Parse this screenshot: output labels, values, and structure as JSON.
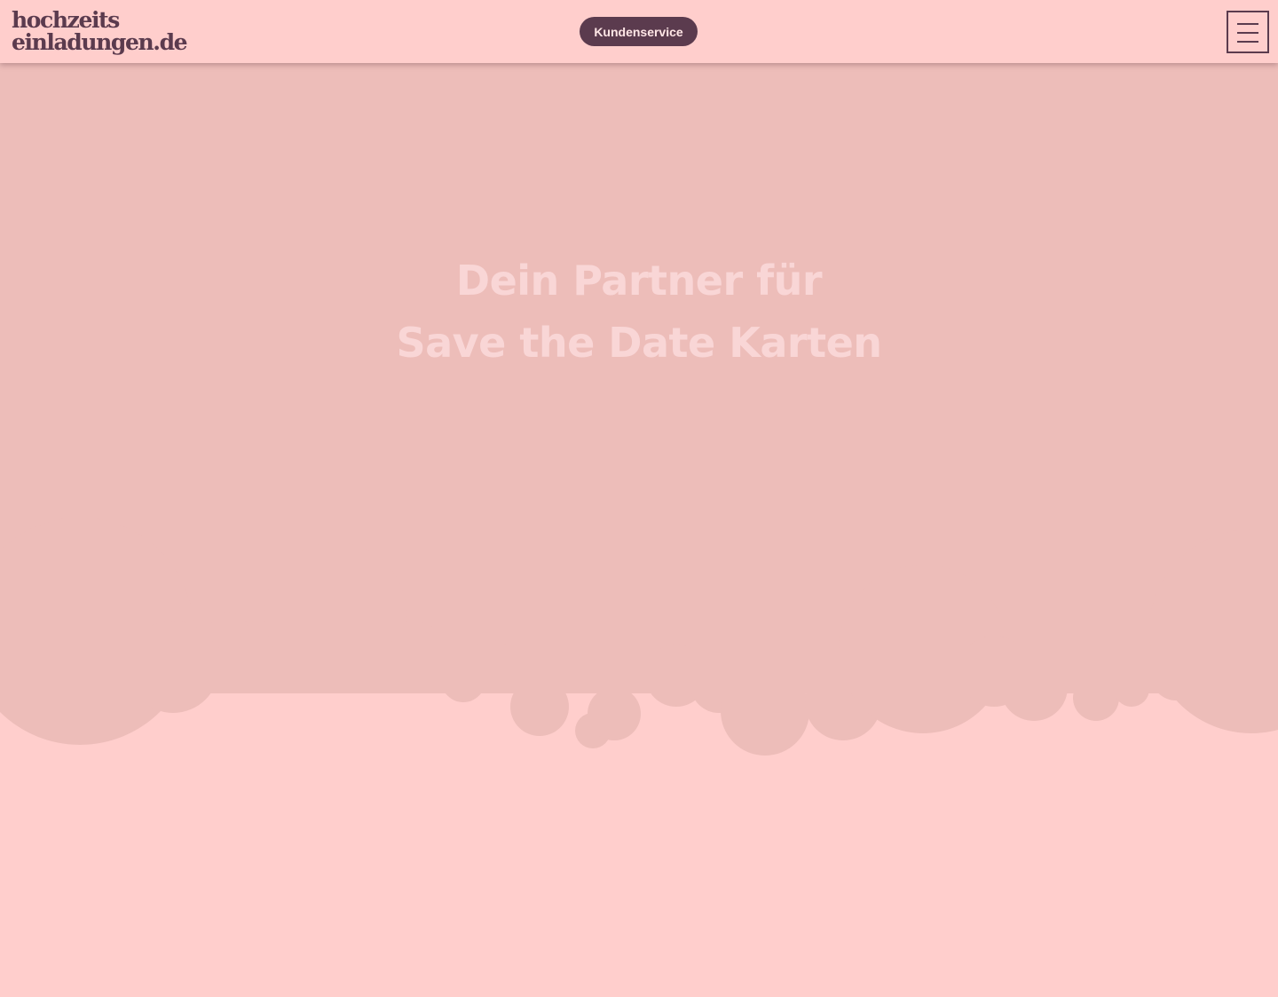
{
  "header": {
    "logo": {
      "line1": "hochzeits",
      "line2": "einladungen.de"
    },
    "service_button_label": "Kundenservice",
    "menu_icon": "hamburger-menu-icon"
  },
  "hero": {
    "title_line1": "Dein Partner für",
    "title_line2": "Save the Date Karten"
  },
  "colors": {
    "background": "#ffcecc",
    "hero_overlay": "#edbdb9",
    "brand": "#5b3b4e",
    "hero_text": "#f9d6d6"
  }
}
